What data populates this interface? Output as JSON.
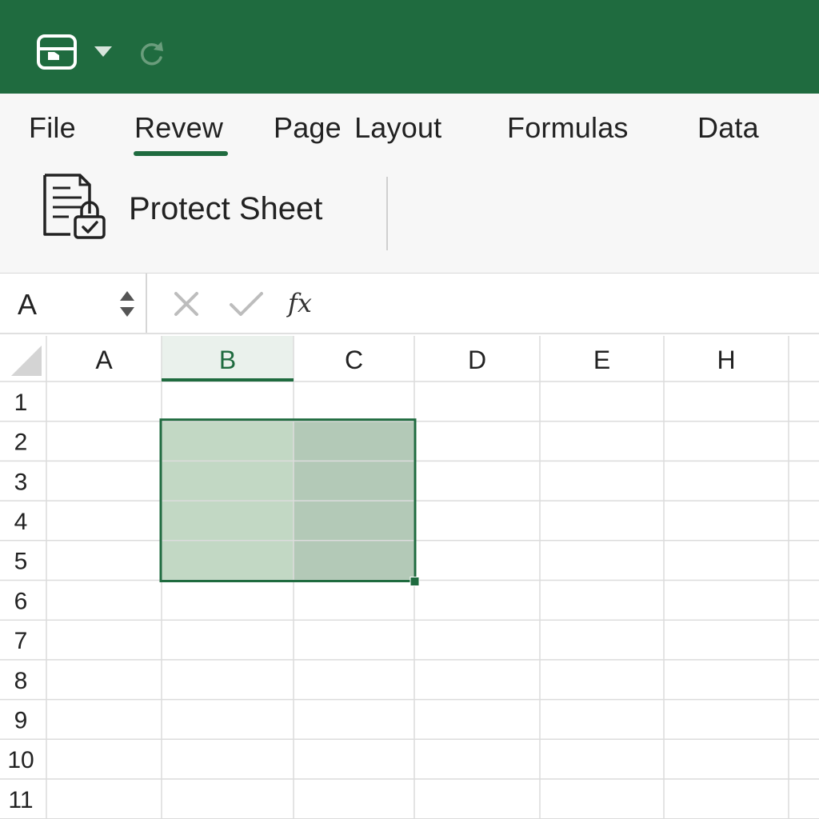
{
  "quick_access": {
    "save_icon": "save-icon",
    "dropdown_icon": "caret-down-icon",
    "redo_icon": "redo-icon"
  },
  "ribbon": {
    "tabs": [
      {
        "label": "File"
      },
      {
        "label": "Revew"
      },
      {
        "label": "Page Layout"
      },
      {
        "label": "Formulas"
      },
      {
        "label": "Data"
      }
    ],
    "active_tab": "Revew",
    "protect_sheet": {
      "label": "Protect Sheet",
      "icon": "protect-sheet-icon"
    }
  },
  "formula_bar": {
    "name_box": "A",
    "function_label": "fx",
    "value": ""
  },
  "grid": {
    "columns": [
      "A",
      "B",
      "C",
      "D",
      "E",
      "H"
    ],
    "active_column": "B",
    "rows": [
      "1",
      "2",
      "3",
      "4",
      "5",
      "6",
      "7",
      "8",
      "9",
      "10",
      "11"
    ],
    "selection": {
      "range": "B2:C5"
    }
  },
  "colors": {
    "brand": "#1f6b3f",
    "selection_light": "#c2d8c4",
    "selection_dark": "#b3c9b7",
    "gridline": "#dcdcdc"
  }
}
